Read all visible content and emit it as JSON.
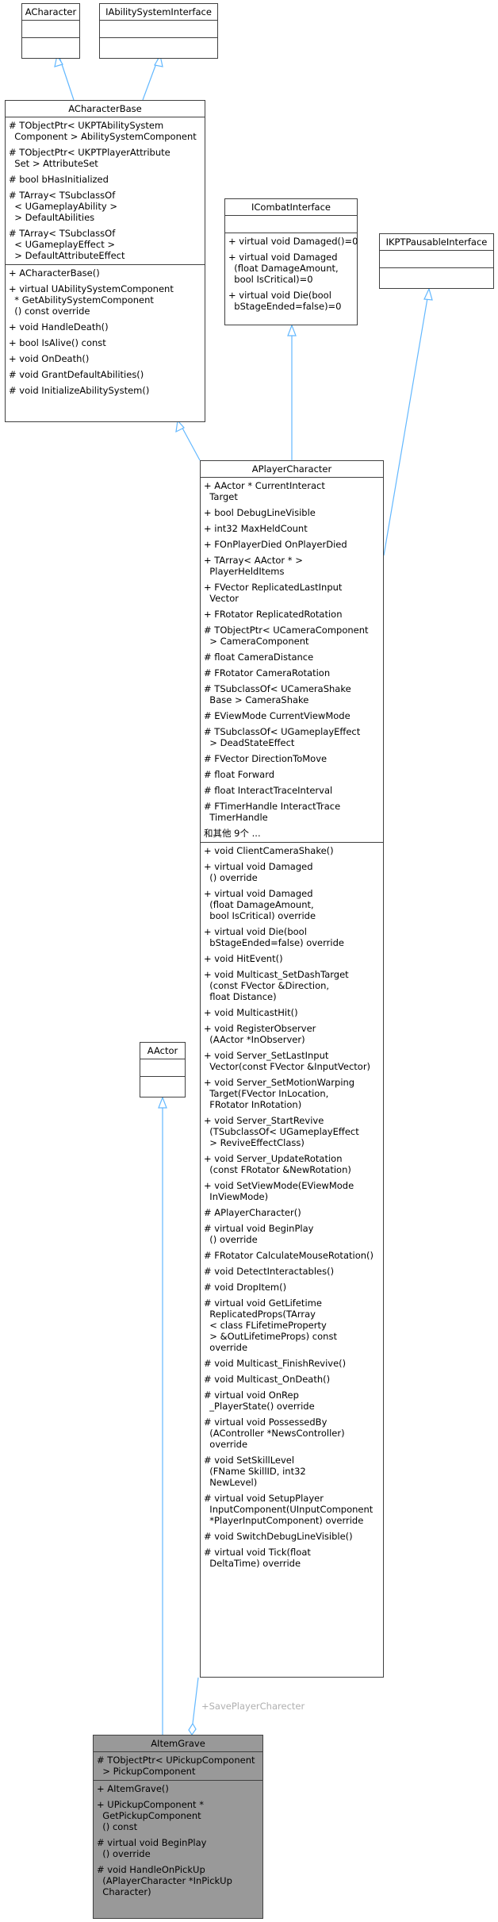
{
  "classes": {
    "acharacter": {
      "name": "ACharacter",
      "attrs": [],
      "methods": []
    },
    "iability": {
      "name": "IAbilitySystemInterface",
      "attrs": [],
      "methods": []
    },
    "acharbase": {
      "name": "ACharacterBase",
      "attrs": [
        "# TObjectPtr< UKPTAbilitySystem\n  Component > AbilitySystemComponent",
        "# TObjectPtr< UKPTPlayerAttribute\n  Set > AttributeSet",
        "# bool bHasInitialized",
        "# TArray< TSubclassOf\n  < UGameplayAbility >\n  > DefaultAbilities",
        "# TArray< TSubclassOf\n  < UGameplayEffect >\n  > DefaultAttributeEffect"
      ],
      "methods": [
        "+ ACharacterBase()",
        "+ virtual UAbilitySystemComponent\n  * GetAbilitySystemComponent\n  () const override",
        "+ void HandleDeath()",
        "+ bool IsAlive() const",
        "+ void OnDeath()",
        "# void GrantDefaultAbilities()",
        "# void InitializeAbilitySystem()"
      ]
    },
    "icombat": {
      "name": "ICombatInterface",
      "attrs": [],
      "methods": [
        "+ virtual void Damaged()=0",
        "+ virtual void Damaged\n  (float DamageAmount,\n  bool IsCritical)=0",
        "+ virtual void Die(bool\n  bStageEnded=false)=0"
      ]
    },
    "ipausable": {
      "name": "IKPTPausableInterface",
      "attrs": [],
      "methods": []
    },
    "aplayer": {
      "name": "APlayerCharacter",
      "attrs": [
        "+ AActor * CurrentInteract\n  Target",
        "+ bool DebugLineVisible",
        "+ int32 MaxHeldCount",
        "+ FOnPlayerDied OnPlayerDied",
        "+ TArray< AActor * >\n  PlayerHeldItems",
        "+ FVector ReplicatedLastInput\n  Vector",
        "+ FRotator ReplicatedRotation",
        "# TObjectPtr< UCameraComponent\n  > CameraComponent",
        "# float CameraDistance",
        "# FRotator CameraRotation",
        "# TSubclassOf< UCameraShake\n  Base > CameraShake",
        "# EViewMode CurrentViewMode",
        "# TSubclassOf< UGameplayEffect\n  > DeadStateEffect",
        "# FVector DirectionToMove",
        "# float Forward",
        "# float InteractTraceInterval",
        "# FTimerHandle InteractTrace\n  TimerHandle",
        "和其他 9个 ..."
      ],
      "methods": [
        "+ void ClientCameraShake()",
        "+ virtual void Damaged\n  () override",
        "+ virtual void Damaged\n  (float DamageAmount,\n  bool IsCritical) override",
        "+ virtual void Die(bool\n  bStageEnded=false) override",
        "+ void HitEvent()",
        "+ void Multicast_SetDashTarget\n  (const FVector &Direction,\n  float Distance)",
        "+ void MulticastHit()",
        "+ void RegisterObserver\n  (AActor *InObserver)",
        "+ void Server_SetLastInput\n  Vector(const FVector &InputVector)",
        "+ void Server_SetMotionWarping\n  Target(FVector InLocation,\n  FRotator InRotation)",
        "+ void Server_StartRevive\n  (TSubclassOf< UGameplayEffect\n  > ReviveEffectClass)",
        "+ void Server_UpdateRotation\n  (const FRotator &NewRotation)",
        "+ void SetViewMode(EViewMode\n  InViewMode)",
        "# APlayerCharacter()",
        "# virtual void BeginPlay\n  () override",
        "# FRotator CalculateMouseRotation()",
        "# void DetectInteractables()",
        "# void DropItem()",
        "# virtual void GetLifetime\n  ReplicatedProps(TArray\n  < class FLifetimeProperty\n  > &OutLifetimeProps) const\n  override",
        "# void Multicast_FinishRevive()",
        "# void Multicast_OnDeath()",
        "# virtual void OnRep\n  _PlayerState() override",
        "# virtual void PossessedBy\n  (AController *NewsController)\n  override",
        "# void SetSkillLevel\n  (FName SkillID, int32\n  NewLevel)",
        "# virtual void SetupPlayer\n  InputComponent(UInputComponent\n  *PlayerInputComponent) override",
        "# void SwitchDebugLineVisible()",
        "# virtual void Tick(float\n  DeltaTime) override"
      ]
    },
    "aactor": {
      "name": "AActor",
      "attrs": [],
      "methods": []
    },
    "aitemgrave": {
      "name": "AItemGrave",
      "attrs": [
        "# TObjectPtr< UPickupComponent\n  > PickupComponent"
      ],
      "methods": [
        "+ AItemGrave()",
        "+ UPickupComponent *\n  GetPickupComponent\n  () const",
        "# virtual void BeginPlay\n  () override",
        "# void HandleOnPickUp\n  (APlayerCharacter *InPickUp\n  Character)"
      ]
    }
  },
  "association_label": "+SavePlayerCharecter",
  "colors": {
    "edge": "#63b8ff",
    "border": "#404040",
    "focus_fill": "#999999",
    "label": "#b0b0b0"
  }
}
